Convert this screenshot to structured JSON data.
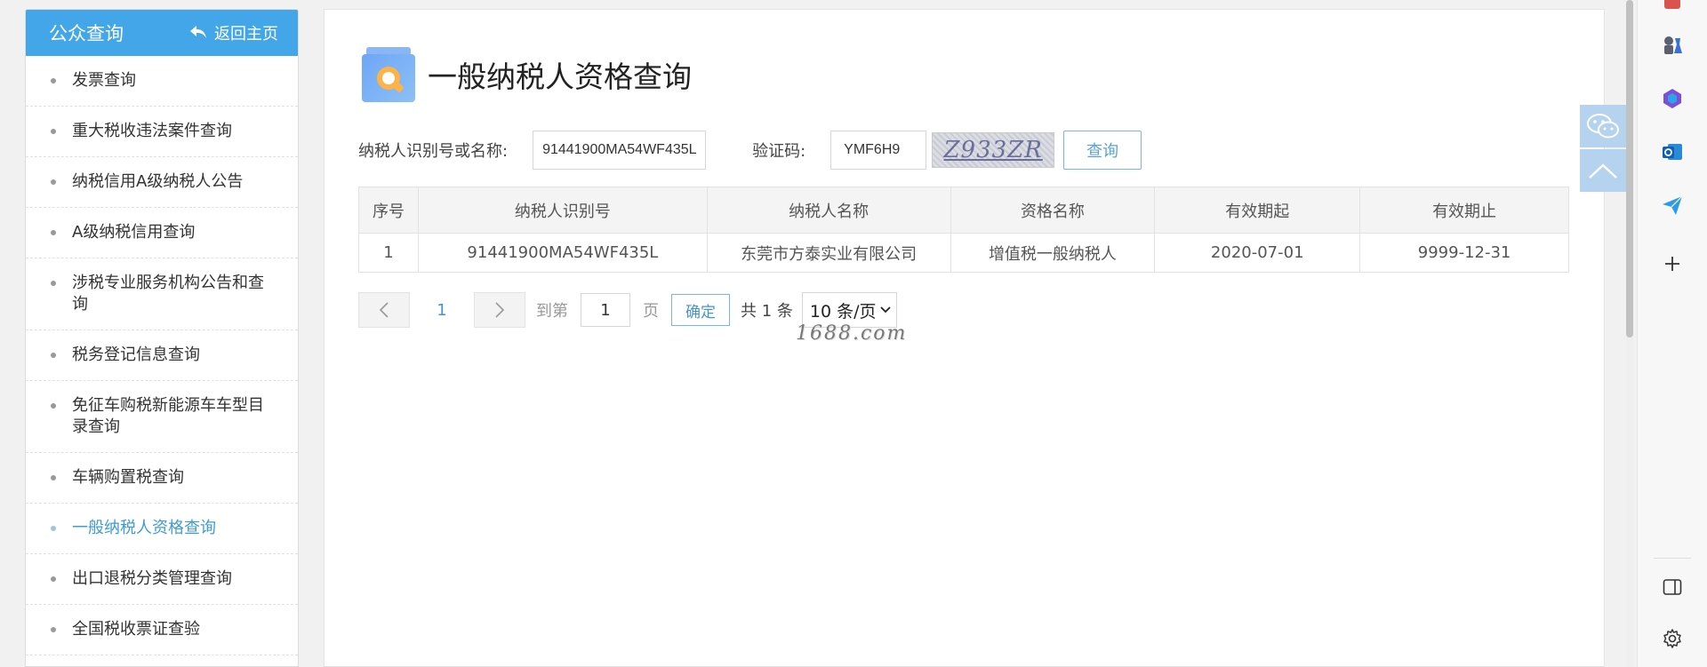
{
  "sidebar": {
    "title": "公众查询",
    "back_label": "返回主页",
    "items": [
      {
        "label": "发票查询"
      },
      {
        "label": "重大税收违法案件查询"
      },
      {
        "label": "纳税信用A级纳税人公告"
      },
      {
        "label": "A级纳税信用查询"
      },
      {
        "label": "涉税专业服务机构公告和查询"
      },
      {
        "label": "税务登记信息查询"
      },
      {
        "label": "免征车购税新能源车车型目录查询"
      },
      {
        "label": "车辆购置税查询"
      },
      {
        "label": "一般纳税人资格查询"
      },
      {
        "label": "出口退税分类管理查询"
      },
      {
        "label": "全国税收票证查验"
      }
    ]
  },
  "main": {
    "title": "一般纳税人资格查询",
    "search": {
      "taxpayer_label": "纳税人识别号或名称:",
      "taxpayer_value": "91441900MA54WF435L",
      "captcha_label": "验证码:",
      "captcha_value": "YMF6H9",
      "captcha_image_text": "Z933ZR",
      "query_label": "查询"
    },
    "table": {
      "headers": [
        "序号",
        "纳税人识别号",
        "纳税人名称",
        "资格名称",
        "有效期起",
        "有效期止"
      ],
      "rows": [
        [
          "1",
          "91441900MA54WF435L",
          "东莞市方泰实业有限公司",
          "增值税一般纳税人",
          "2020-07-01",
          "9999-12-31"
        ]
      ]
    },
    "pagination": {
      "current_page": "1",
      "goto_label": "到第",
      "goto_value": "1",
      "page_unit": "页",
      "confirm_label": "确定",
      "total_label": "共 1 条",
      "page_size_label": "10 条/页"
    }
  },
  "watermark": "1688.com",
  "colors": {
    "accent": "#42a6e8",
    "active_menu": "#3e9bd4",
    "link": "#4a93c9"
  }
}
